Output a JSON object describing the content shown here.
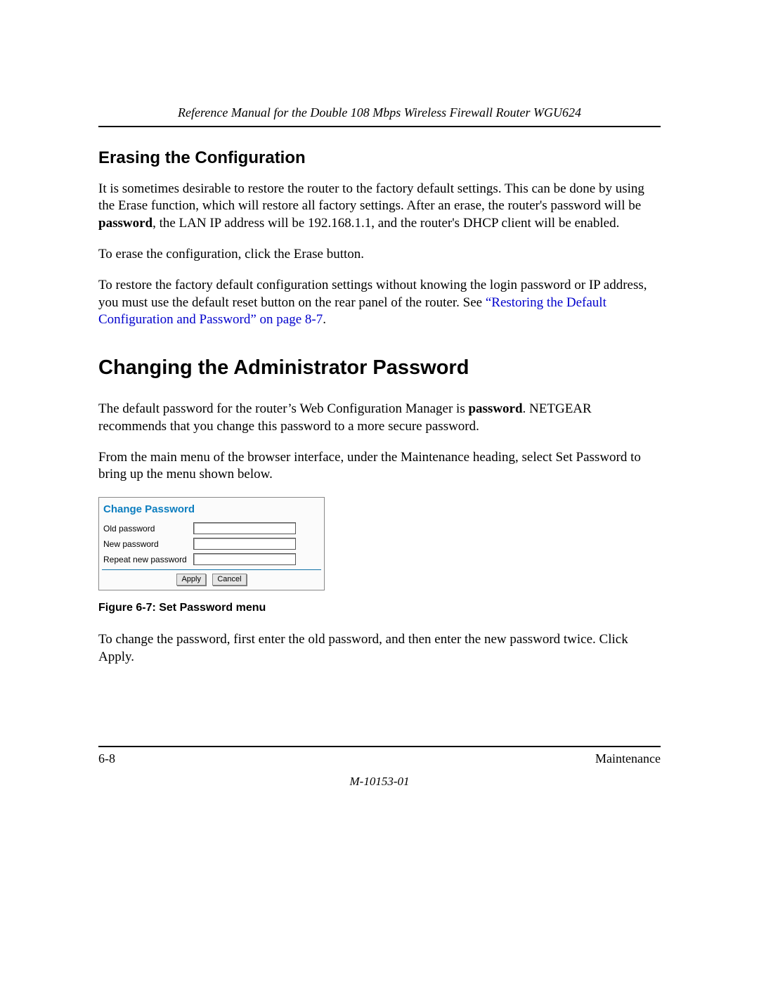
{
  "header": {
    "title": "Reference Manual for the Double 108 Mbps Wireless Firewall Router WGU624"
  },
  "sections": {
    "erasing_title": "Erasing the Configuration",
    "erasing_p1_a": "It is sometimes desirable to restore the router to the factory default settings. This can be done by using the Erase function, which will restore all factory settings. After an erase, the router's password will be ",
    "erasing_p1_bold": "password",
    "erasing_p1_b": ", the LAN IP address will be 192.168.1.1, and the router's DHCP client will be enabled.",
    "erasing_p2": "To erase the configuration, click the Erase button.",
    "erasing_p3_a": "To restore the factory default configuration settings without knowing the login password or IP address, you must use the default reset button on the rear panel of the router. See ",
    "erasing_p3_link": "“Restoring the Default Configuration and Password” on page 8-7",
    "erasing_p3_b": ".",
    "changing_title": "Changing the Administrator Password",
    "changing_p1_a": "The default password for the router’s Web Configuration Manager is ",
    "changing_p1_bold": "password",
    "changing_p1_b": ". NETGEAR recommends that you change this password to a more secure password.",
    "changing_p2": "From the main menu of the browser interface, under the Maintenance heading, select Set Password to bring up the menu shown below.",
    "figure_caption": "Figure 6-7:  Set Password menu",
    "changing_p3": "To change the password, first enter the old password, and then enter the new password twice. Click Apply."
  },
  "form": {
    "title": "Change Password",
    "old_label": "Old password",
    "new_label": "New password",
    "repeat_label": "Repeat new password",
    "old_value": "",
    "new_value": "",
    "repeat_value": "",
    "apply": "Apply",
    "cancel": "Cancel"
  },
  "footer": {
    "page": "6-8",
    "section": "Maintenance",
    "docid": "M-10153-01"
  }
}
